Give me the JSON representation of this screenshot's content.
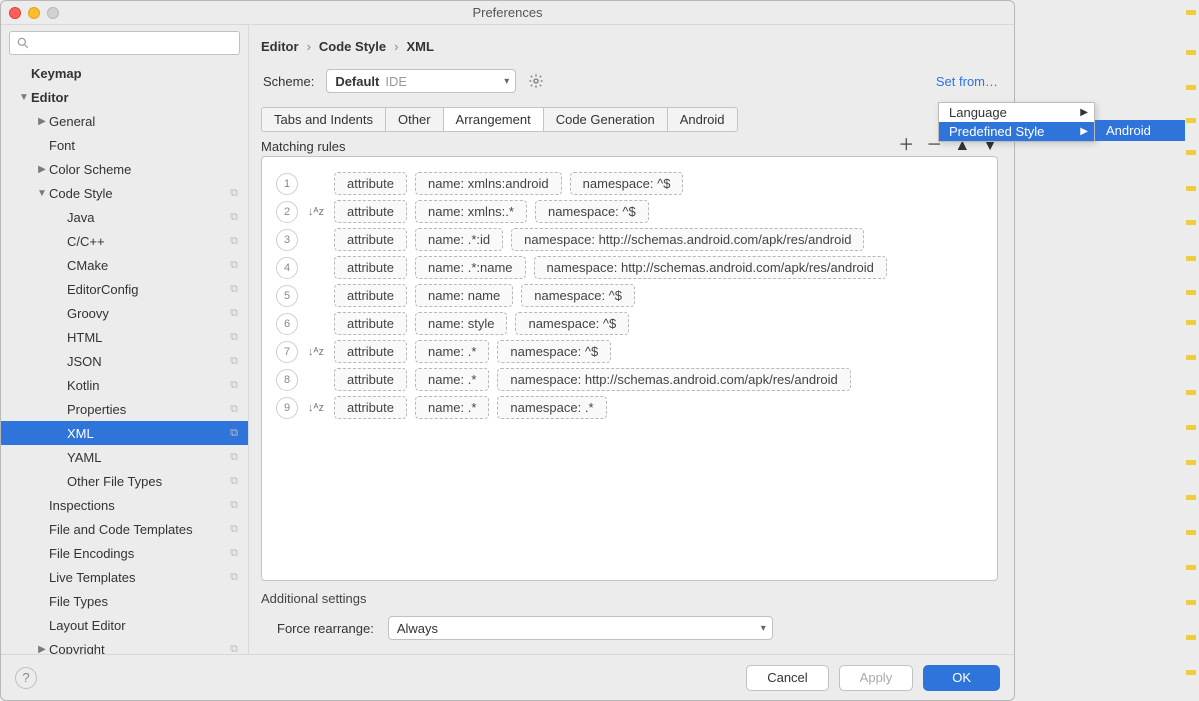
{
  "window": {
    "title": "Preferences"
  },
  "breadcrumb": {
    "a": "Editor",
    "b": "Code Style",
    "c": "XML"
  },
  "scheme": {
    "label": "Scheme:",
    "value": "Default",
    "ide": "IDE"
  },
  "setfrom": "Set from…",
  "tabs": [
    "Tabs and Indents",
    "Other",
    "Arrangement",
    "Code Generation",
    "Android"
  ],
  "activeTab": 2,
  "section_rules": "Matching rules",
  "rules": [
    {
      "n": "1",
      "sort": false,
      "attr": "attribute",
      "name": "name: xmlns:android",
      "ns": "namespace: ^$"
    },
    {
      "n": "2",
      "sort": true,
      "attr": "attribute",
      "name": "name: xmlns:.*",
      "ns": "namespace: ^$"
    },
    {
      "n": "3",
      "sort": false,
      "attr": "attribute",
      "name": "name: .*:id",
      "ns": "namespace: http://schemas.android.com/apk/res/android"
    },
    {
      "n": "4",
      "sort": false,
      "attr": "attribute",
      "name": "name: .*:name",
      "ns": "namespace: http://schemas.android.com/apk/res/android"
    },
    {
      "n": "5",
      "sort": false,
      "attr": "attribute",
      "name": "name: name",
      "ns": "namespace: ^$"
    },
    {
      "n": "6",
      "sort": false,
      "attr": "attribute",
      "name": "name: style",
      "ns": "namespace: ^$"
    },
    {
      "n": "7",
      "sort": true,
      "attr": "attribute",
      "name": "name: .*",
      "ns": "namespace: ^$"
    },
    {
      "n": "8",
      "sort": false,
      "attr": "attribute",
      "name": "name: .*",
      "ns": "namespace: http://schemas.android.com/apk/res/android"
    },
    {
      "n": "9",
      "sort": true,
      "attr": "attribute",
      "name": "name: .*",
      "ns": "namespace: .*"
    }
  ],
  "additional": "Additional settings",
  "force": {
    "label": "Force rearrange:",
    "value": "Always"
  },
  "buttons": {
    "cancel": "Cancel",
    "apply": "Apply",
    "ok": "OK"
  },
  "sidebar": [
    {
      "label": "Keymap",
      "depth": 0,
      "bold": true,
      "arrow": ""
    },
    {
      "label": "Editor",
      "depth": 0,
      "bold": true,
      "arrow": "▼"
    },
    {
      "label": "General",
      "depth": 1,
      "arrow": "▶"
    },
    {
      "label": "Font",
      "depth": 1,
      "arrow": ""
    },
    {
      "label": "Color Scheme",
      "depth": 1,
      "arrow": "▶"
    },
    {
      "label": "Code Style",
      "depth": 1,
      "arrow": "▼",
      "glyph": "⧉"
    },
    {
      "label": "Java",
      "depth": 2,
      "glyph": "⧉"
    },
    {
      "label": "C/C++",
      "depth": 2,
      "glyph": "⧉"
    },
    {
      "label": "CMake",
      "depth": 2,
      "glyph": "⧉"
    },
    {
      "label": "EditorConfig",
      "depth": 2,
      "glyph": "⧉"
    },
    {
      "label": "Groovy",
      "depth": 2,
      "glyph": "⧉"
    },
    {
      "label": "HTML",
      "depth": 2,
      "glyph": "⧉"
    },
    {
      "label": "JSON",
      "depth": 2,
      "glyph": "⧉"
    },
    {
      "label": "Kotlin",
      "depth": 2,
      "glyph": "⧉"
    },
    {
      "label": "Properties",
      "depth": 2,
      "glyph": "⧉"
    },
    {
      "label": "XML",
      "depth": 2,
      "glyph": "⧉",
      "selected": true
    },
    {
      "label": "YAML",
      "depth": 2,
      "glyph": "⧉"
    },
    {
      "label": "Other File Types",
      "depth": 2,
      "glyph": "⧉"
    },
    {
      "label": "Inspections",
      "depth": 1,
      "glyph": "⧉"
    },
    {
      "label": "File and Code Templates",
      "depth": 1,
      "glyph": "⧉"
    },
    {
      "label": "File Encodings",
      "depth": 1,
      "glyph": "⧉"
    },
    {
      "label": "Live Templates",
      "depth": 1,
      "glyph": "⧉"
    },
    {
      "label": "File Types",
      "depth": 1
    },
    {
      "label": "Layout Editor",
      "depth": 1
    },
    {
      "label": "Copyright",
      "depth": 1,
      "arrow": "▶",
      "glyph": "⧉"
    }
  ],
  "menu1": {
    "items": [
      "Language",
      "Predefined Style"
    ],
    "hl": 1
  },
  "menu2": {
    "items": [
      "Android"
    ]
  }
}
